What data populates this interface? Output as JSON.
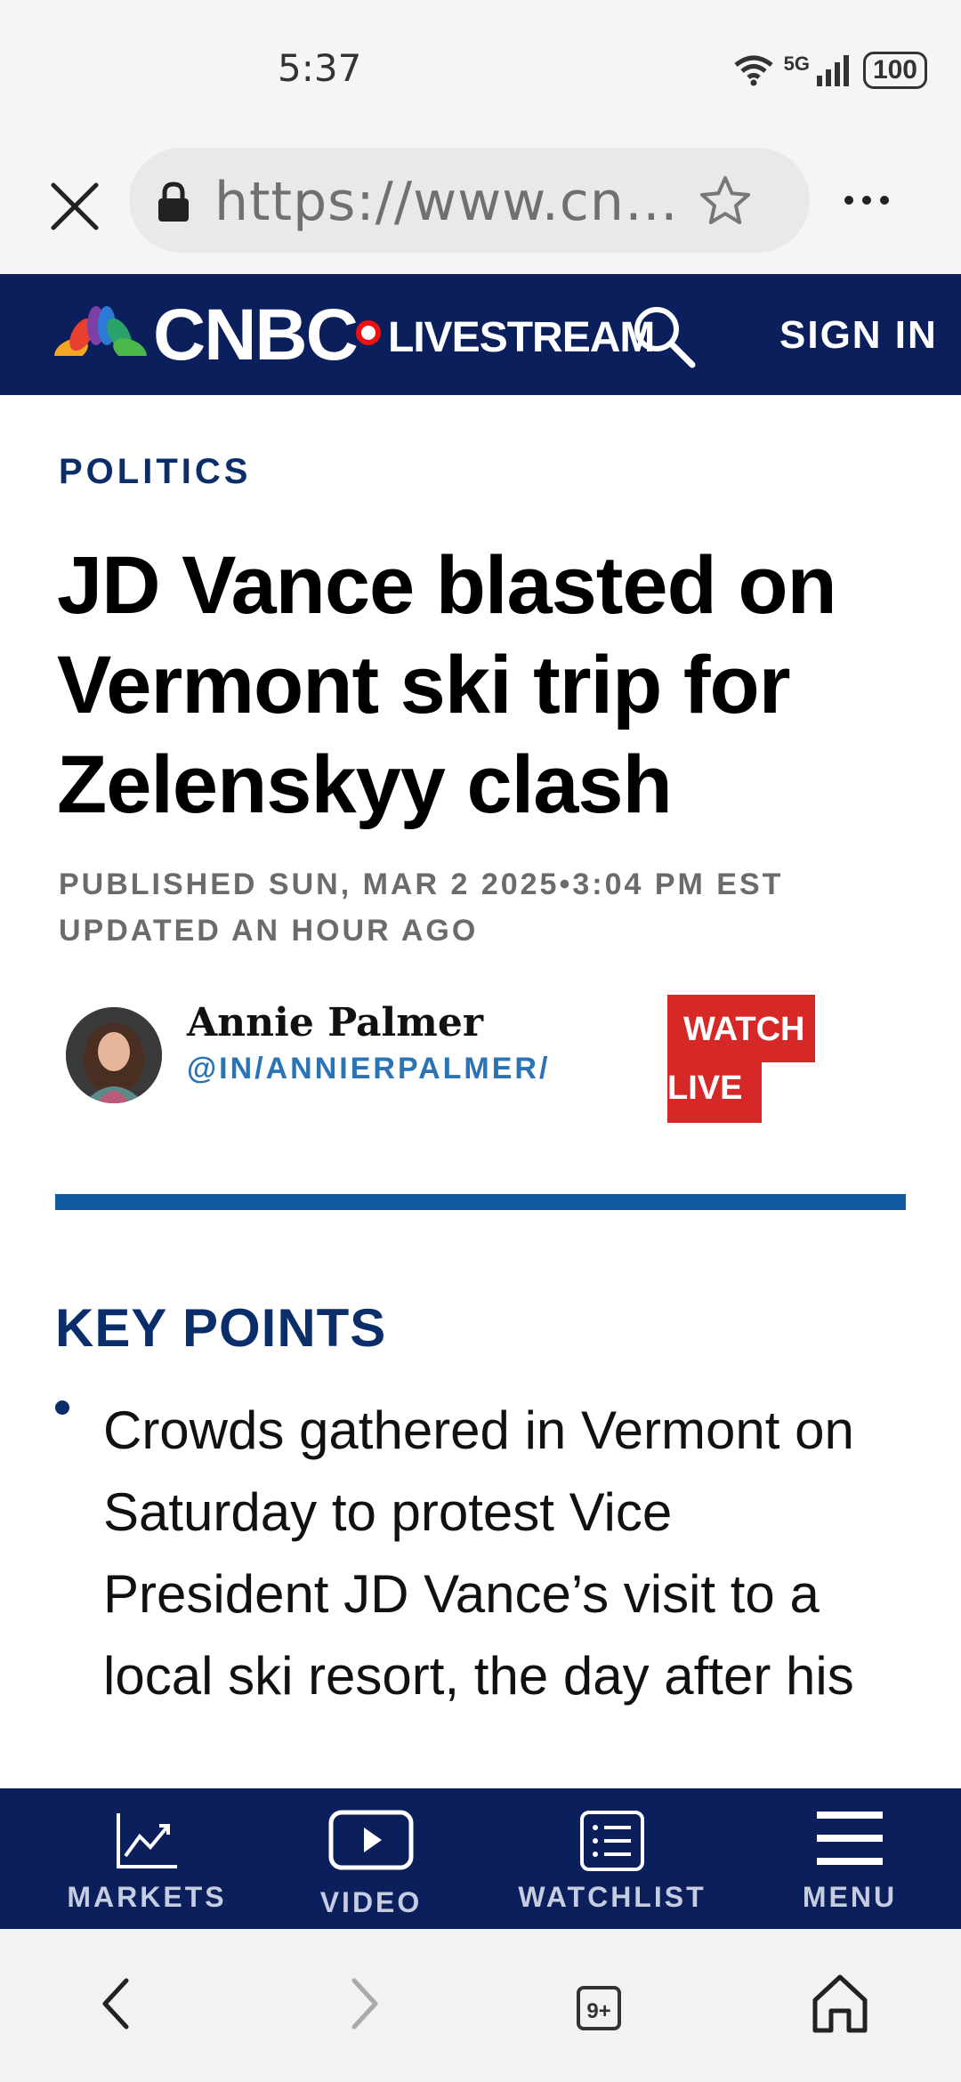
{
  "status_bar": {
    "time": "5:37",
    "network": "5G",
    "battery": "100"
  },
  "browser": {
    "url": "https://www.cn…"
  },
  "header": {
    "brand": "CNBC",
    "livestream": "LIVESTREAM",
    "sign_in": "SIGN IN",
    "colors": {
      "navy": "#0b1f5c",
      "live_red": "#e11111"
    }
  },
  "article": {
    "section": "POLITICS",
    "headline": "JD Vance blasted on Vermont ski trip for Zelenskyy clash",
    "published": "PUBLISHED SUN, MAR 2 2025•3:04 PM EST",
    "updated": "UPDATED AN HOUR AGO",
    "author_name": "Annie Palmer",
    "author_handle": "@IN/ANNIERPALMER/",
    "watch_line1": "WATCH",
    "watch_line2": "LIVE",
    "key_points_title": "KEY POINTS",
    "key_point_1": "Crowds gathered in Vermont on Saturday to protest Vice President JD Vance’s visit to a local ski resort, the day after his"
  },
  "tabs": [
    {
      "label": "MARKETS",
      "icon": "chart-icon"
    },
    {
      "label": "VIDEO",
      "icon": "play-icon"
    },
    {
      "label": "WATCHLIST",
      "icon": "list-icon"
    },
    {
      "label": "MENU",
      "icon": "hamburger-icon"
    }
  ],
  "browser_nav": {
    "tabs_count": "9+"
  }
}
